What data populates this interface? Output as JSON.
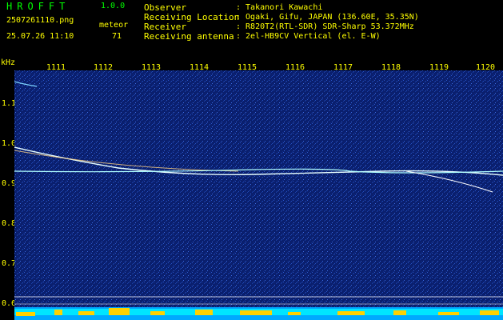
{
  "header": {
    "app_name": "HROFFT",
    "version": "1.0.0",
    "filename": "2507261110.png",
    "meteor_label": "meteor",
    "datetime": "25.07.26 11:10",
    "meteor_count": "71",
    "info": [
      {
        "label": "Observer",
        "value": ": Takanori Kawachi"
      },
      {
        "label": "Receiving Location",
        "value": ": Ogaki, Gifu, JAPAN (136.60E, 35.35N)"
      },
      {
        "label": "Receiver",
        "value": ": R820T2(RTL-SDR) SDR-Sharp 53.372MHz"
      },
      {
        "label": "Receiving antenna",
        "value": ": 2el-HB9CV Vertical (el. E-W)"
      }
    ]
  },
  "axis": {
    "unit": "kHz",
    "x_ticks": [
      "1111",
      "1112",
      "1113",
      "1114",
      "1115",
      "1116",
      "1117",
      "1118",
      "1119",
      "1120"
    ],
    "y_ticks": [
      "1.1",
      "1.0",
      "0.9",
      "0.8",
      "0.7",
      "0.6"
    ]
  },
  "colors": {
    "background": "#000000",
    "text": "#ffff00",
    "title": "#00ff00",
    "noise": "#0a1f6e",
    "trace": "#ffffff",
    "spectrum": "#00e5ff"
  }
}
